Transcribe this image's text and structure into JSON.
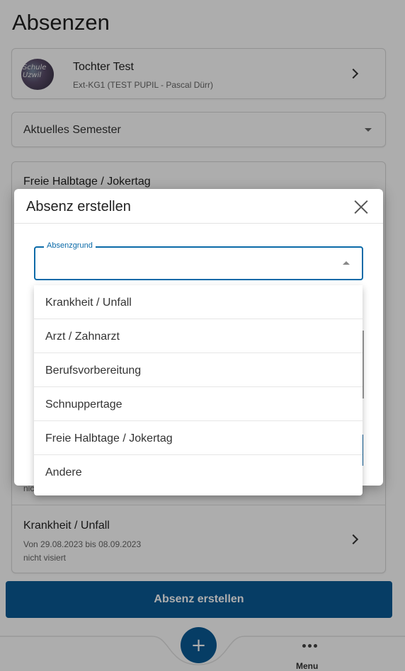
{
  "page": {
    "title": "Absenzen"
  },
  "profile": {
    "avatar_text": "Schule Uzwil",
    "name": "Tochter Test",
    "subtitle": "Ext-KG1 (TEST PUPIL - Pascal Dürr)"
  },
  "semester_select": {
    "value": "Aktuelles Semester"
  },
  "absence_list": {
    "header": "Freie Halbtage / Jokertag",
    "previous_status_fragment": "nic",
    "items": [
      {
        "title": "Krankheit / Unfall",
        "dates": "Von 29.08.2023 bis 08.09.2023",
        "status": "nicht visiert"
      }
    ]
  },
  "create_button": {
    "label": "Absenz erstellen"
  },
  "bottom_nav": {
    "fab_symbol": "+",
    "menu_label": "Menu"
  },
  "dialog": {
    "title": "Absenz erstellen",
    "field": {
      "label": "Absenzgrund",
      "value": ""
    },
    "options": [
      "Krankheit / Unfall",
      "Arzt / Zahnarzt",
      "Berufsvorbereitung",
      "Schnuppertage",
      "Freie Halbtage / Jokertag",
      "Andere"
    ]
  },
  "colors": {
    "primary": "#0a5b96",
    "focus": "#0a6aa8"
  },
  "icons": [
    "chevron-right-icon",
    "caret-down-icon",
    "caret-up-icon",
    "close-icon",
    "plus-icon",
    "more-dots-icon"
  ]
}
